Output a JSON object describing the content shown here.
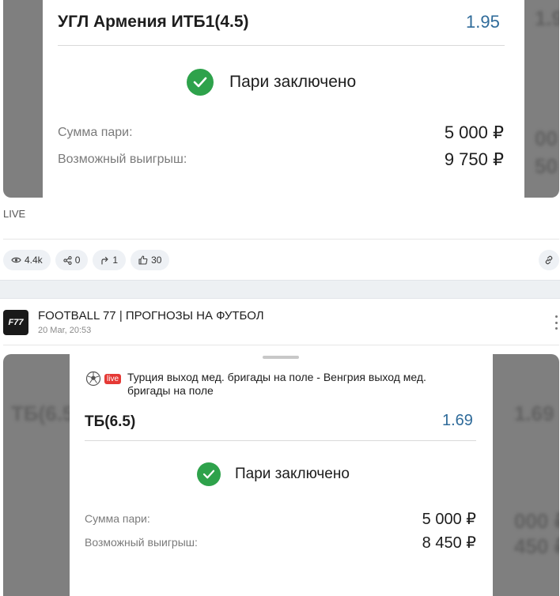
{
  "post1": {
    "bet": {
      "title": "УГЛ Армения ИТБ1(4.5)",
      "odds": "1.95",
      "status": "Пари заключено",
      "stake_label": "Сумма пари:",
      "stake_value": "5 000 ₽",
      "win_label": "Возможный выигрыш:",
      "win_value": "9 750 ₽"
    },
    "caption": "LIVE",
    "actions": {
      "views": "4.4k",
      "shares": "0",
      "reposts": "1",
      "likes": "30"
    }
  },
  "post2": {
    "channel": "FOOTBALL 77 | ПРОГНОЗЫ НА ФУТБОЛ",
    "avatar_text": "F77",
    "time": "20 Mar, 20:53",
    "bet": {
      "live_badge": "live",
      "match": "Турция выход мед. бригады на поле - Венгрия выход мед. бригады на поле",
      "title": "ТБ(6.5)",
      "odds": "1.69",
      "status": "Пари заключено",
      "stake_label": "Сумма пари:",
      "stake_value": "5 000 ₽",
      "win_label": "Возможный выигрыш:",
      "win_value": "8 450 ₽"
    }
  },
  "colors": {
    "odds": "#2f6b9a",
    "success": "#2ea24b",
    "live": "#e53935"
  }
}
